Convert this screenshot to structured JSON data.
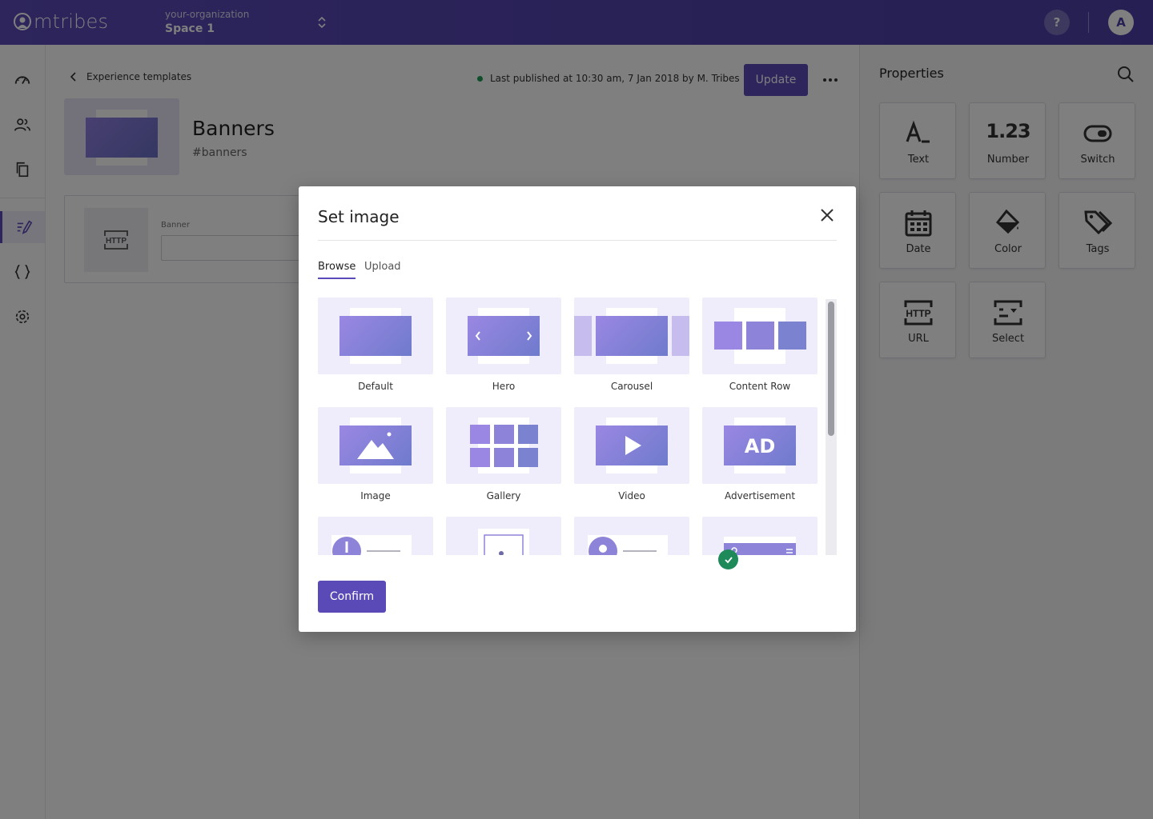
{
  "app": {
    "logo_text": "mtribes"
  },
  "topbar": {
    "org_name": "your-organization",
    "space_name": "Space 1",
    "help_label": "?",
    "avatar_initial": "A"
  },
  "rail": {
    "items": [
      "dashboard-icon",
      "users-icon",
      "copy-icon",
      "edit-icon",
      "code-braces-icon",
      "gear-icon"
    ],
    "active_item": "edit-icon"
  },
  "header": {
    "back_label": "Experience templates",
    "status_text": "Last published at 10:30 am, 7 Jan 2018 by M. Tribes",
    "update_label": "Update",
    "title": "Banners",
    "slug": "#banners"
  },
  "field": {
    "icon_text": "HTTP",
    "label": "Banner",
    "value": ""
  },
  "panel": {
    "title": "Properties",
    "properties": [
      {
        "label": "Text",
        "icon": "text-icon"
      },
      {
        "label": "Number",
        "icon": "number-icon",
        "glyph": "1.23"
      },
      {
        "label": "Switch",
        "icon": "switch-icon"
      },
      {
        "label": "Date",
        "icon": "calendar-icon"
      },
      {
        "label": "Color",
        "icon": "paint-bucket-icon"
      },
      {
        "label": "Tags",
        "icon": "tags-icon"
      },
      {
        "label": "URL",
        "icon": "http-icon",
        "glyph": "HTTP"
      },
      {
        "label": "Select",
        "icon": "select-icon"
      }
    ]
  },
  "modal": {
    "title": "Set image",
    "tabs": [
      "Browse",
      "Upload"
    ],
    "active_tab": "Browse",
    "confirm_label": "Confirm",
    "selected_option": "Default",
    "options": [
      {
        "label": "Default",
        "icon": "banner-default-icon"
      },
      {
        "label": "Hero",
        "icon": "banner-hero-icon"
      },
      {
        "label": "Carousel",
        "icon": "banner-carousel-icon"
      },
      {
        "label": "Content Row",
        "icon": "content-row-icon"
      },
      {
        "label": "Image",
        "icon": "image-icon"
      },
      {
        "label": "Gallery",
        "icon": "gallery-icon"
      },
      {
        "label": "Video",
        "icon": "video-icon"
      },
      {
        "label": "Advertisement",
        "icon": "advertisement-icon",
        "glyph": "AD"
      },
      {
        "label": "",
        "icon": "profile-row-icon"
      },
      {
        "label": "",
        "icon": "portrait-icon"
      },
      {
        "label": "",
        "icon": "contact-card-icon"
      },
      {
        "label": "",
        "icon": "header-bar-icon"
      }
    ]
  },
  "colors": {
    "brand": "#5a4ab8",
    "tile_bg": "#efedfb",
    "success": "#1e8a5a",
    "status_dot": "#1f9d55"
  }
}
